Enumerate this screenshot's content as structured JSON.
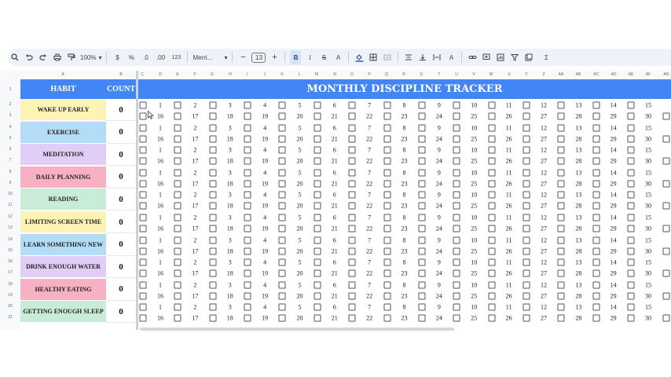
{
  "toolbar": {
    "zoom": "100%",
    "currency": "$",
    "percent": "%",
    "dec_minus": ".0",
    "dec_plus": ".00",
    "format_123": "123",
    "font": "Merri...",
    "font_size": "13",
    "bold": "B",
    "italic": "I",
    "strike": "S",
    "text_color": "A",
    "sigma": "Σ"
  },
  "columns": [
    "A",
    "B",
    "C",
    "D",
    "E",
    "F",
    "G",
    "H",
    "I",
    "J",
    "K",
    "L",
    "M",
    "N",
    "O",
    "P",
    "Q",
    "R",
    "S",
    "T",
    "U",
    "V",
    "W",
    "X",
    "Y",
    "Z",
    "AA",
    "AB",
    "AC",
    "AD",
    "AE",
    "AF",
    "AG"
  ],
  "row_numbers": [
    "1",
    "2",
    "3",
    "4",
    "5",
    "6",
    "7",
    "8",
    "9",
    "10",
    "11",
    "12",
    "13",
    "14",
    "15",
    "16",
    "17",
    "18",
    "19",
    "20",
    "21"
  ],
  "headers": {
    "habit": "HABIT",
    "count": "COUNT",
    "title": "MONTHLY DISCIPLINE TRACKER"
  },
  "habits": [
    {
      "name": "WAKE UP EARLY",
      "count": "0",
      "color": "#fdf3b5"
    },
    {
      "name": "EXERCISE",
      "count": "0",
      "color": "#b3dcf7"
    },
    {
      "name": "MEDITATION",
      "count": "0",
      "color": "#e2cdf6"
    },
    {
      "name": "DAILY PLANNING",
      "count": "0",
      "color": "#f7b1c4"
    },
    {
      "name": "READING",
      "count": "0",
      "color": "#c9ecd6"
    },
    {
      "name": "LIMITING SCREEN TIME",
      "count": "0",
      "color": "#fdf3b5"
    },
    {
      "name": "LEARN SOMETHING NEW",
      "count": "0",
      "color": "#b3dcf7"
    },
    {
      "name": "DRINK ENOUGH WATER",
      "count": "0",
      "color": "#e2cdf6"
    },
    {
      "name": "HEALTHY EATING",
      "count": "0",
      "color": "#f7b1c4"
    },
    {
      "name": "GETTING ENOUGH SLEEP",
      "count": "0",
      "color": "#c9ecd6"
    }
  ],
  "days_top": [
    "1",
    "2",
    "3",
    "4",
    "5",
    "6",
    "7",
    "8",
    "9",
    "10",
    "11",
    "12",
    "13",
    "14",
    "15"
  ],
  "days_bottom": [
    "16",
    "17",
    "18",
    "19",
    "20",
    "21",
    "22",
    "23",
    "24",
    "25",
    "26",
    "27",
    "28",
    "29",
    "30"
  ],
  "colors": {
    "header_blue": "#4285f4",
    "toolbar_bg": "#eef2f9"
  }
}
